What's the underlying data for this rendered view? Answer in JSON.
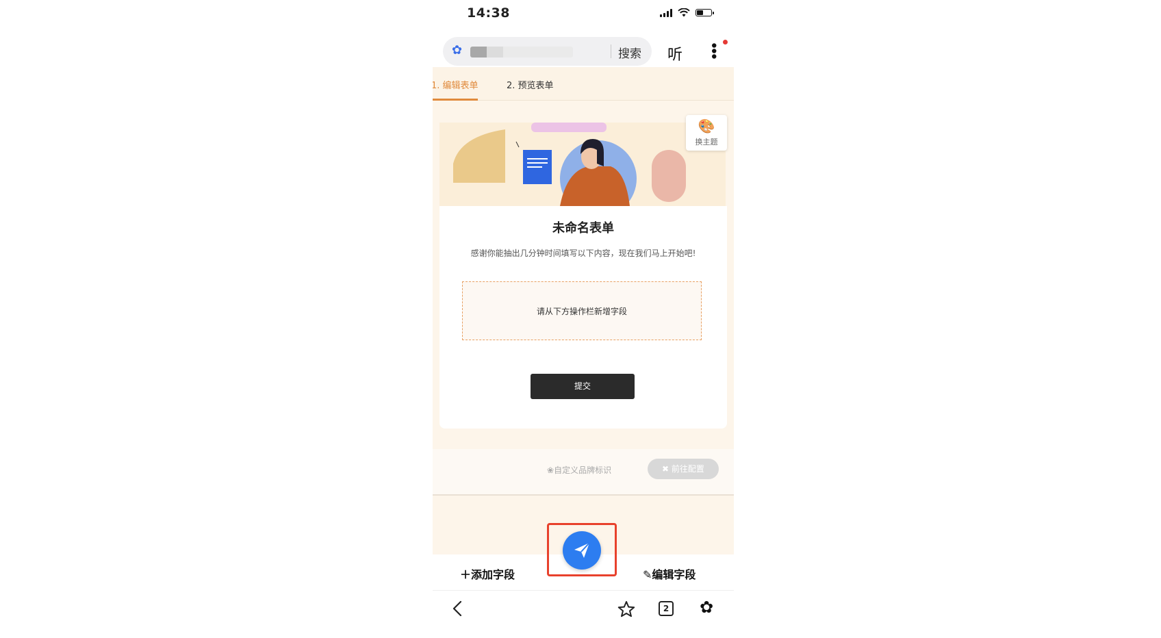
{
  "status_bar": {
    "time": "14:38"
  },
  "browser_header": {
    "search_label": "搜索",
    "listen_label": "听"
  },
  "tabs": [
    {
      "label": "1. 编辑表单",
      "active": true
    },
    {
      "label": "2. 预览表单",
      "active": false
    }
  ],
  "banner": {
    "theme_button_label": "换主题"
  },
  "form": {
    "title": "未命名表单",
    "description": "感谢你能抽出几分钟时间填写以下内容，现在我们马上开始吧!",
    "empty_placeholder": "请从下方操作栏新增字段",
    "submit_label": "提交"
  },
  "brand": {
    "label": "自定义品牌标识",
    "config_button": "前往配置"
  },
  "toolbar": {
    "add_field": "添加字段",
    "edit_field": "编辑字段",
    "fab_icon": "paper-plane-icon"
  },
  "browser_nav": {
    "tab_count": "2"
  },
  "colors": {
    "accent": "#e08a3c",
    "fab": "#2d7df0",
    "highlight_box": "#e8412c",
    "page_bg": "#fdf5ea"
  }
}
